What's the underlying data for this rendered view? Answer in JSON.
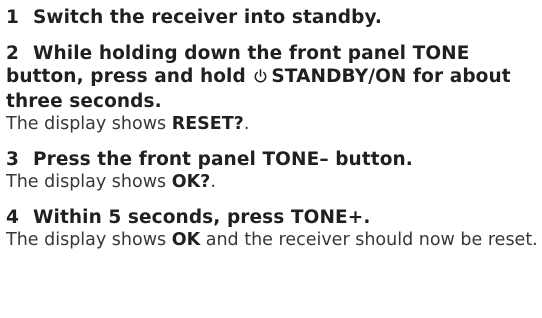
{
  "steps": [
    {
      "number": "1",
      "heading": "Switch the receiver into standby."
    },
    {
      "number": "2",
      "heading_pre": "While holding down the front panel TONE button, press and hold",
      "heading_post": "STANDBY/ON for about three seconds.",
      "icon": "power-icon",
      "body_pre": "The display shows ",
      "body_bold": "RESET?",
      "body_post": "."
    },
    {
      "number": "3",
      "heading": "Press the front panel TONE– button.",
      "body_pre": "The display shows ",
      "body_bold": "OK?",
      "body_post": "."
    },
    {
      "number": "4",
      "heading": "Within 5 seconds, press TONE+.",
      "body_pre": "The display shows ",
      "body_bold": "OK",
      "body_post": " and the receiver should now be reset."
    }
  ]
}
